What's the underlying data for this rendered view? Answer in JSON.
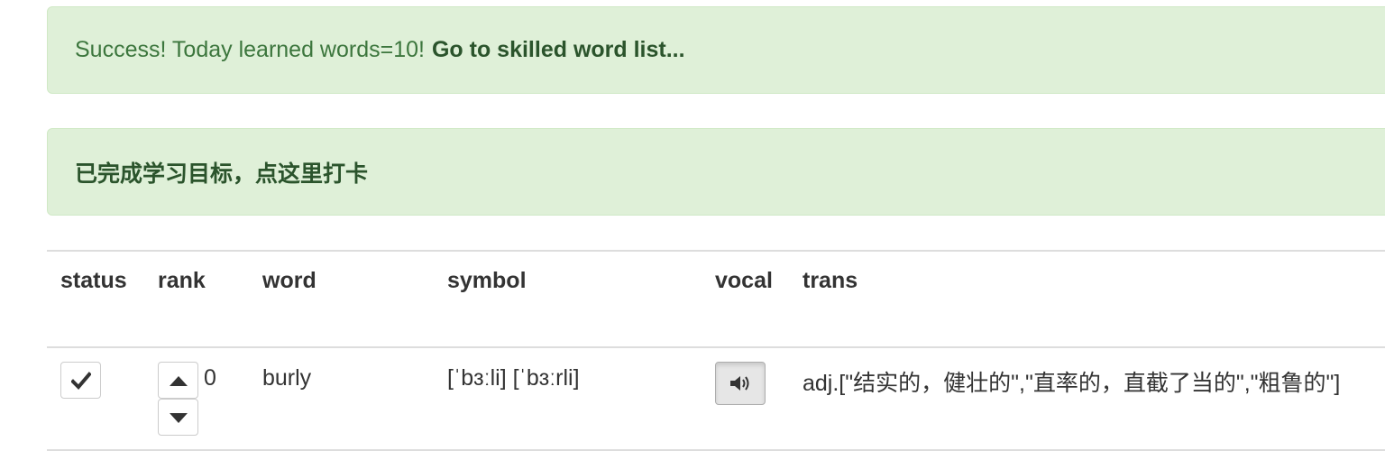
{
  "alert_success": {
    "message": "Success! Today learned words=10!",
    "link_label": "Go to skilled word list..."
  },
  "alert_checkin": {
    "label": "已完成学习目标，点这里打卡"
  },
  "table": {
    "headers": {
      "status": "status",
      "rank": "rank",
      "word": "word",
      "symbol": "symbol",
      "vocal": "vocal",
      "trans": "trans"
    },
    "rows": [
      {
        "rank": "0",
        "word": "burly",
        "symbol": "[ˈbɜːli] [ˈbɜːrli]",
        "trans": "adj.[\"结实的，健壮的\",\"直率的，直截了当的\",\"粗鲁的\"]"
      }
    ]
  },
  "icons": {
    "status": "check-icon",
    "rank_up": "triangle-up-icon",
    "rank_down": "triangle-down-icon",
    "vocal": "volume-icon"
  },
  "colors": {
    "alert_bg": "#dff0d8",
    "alert_text": "#3c763d",
    "alert_link": "#2b542c"
  }
}
